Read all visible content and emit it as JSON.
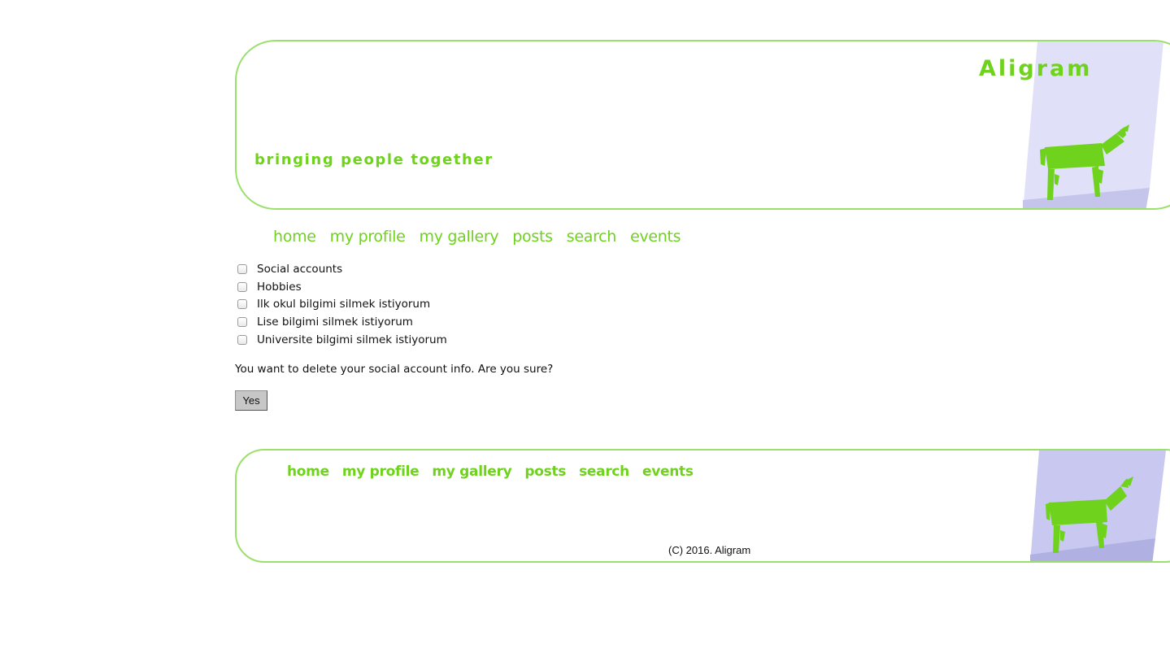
{
  "site": {
    "title": "Aligram",
    "tagline": "bringing people together",
    "brand_color": "#6fd21c",
    "border_color": "#9be06a"
  },
  "nav": {
    "items": [
      {
        "label": "home"
      },
      {
        "label": "my profile"
      },
      {
        "label": "my gallery"
      },
      {
        "label": "posts"
      },
      {
        "label": "search"
      },
      {
        "label": "events"
      }
    ]
  },
  "form": {
    "options": [
      {
        "label": "Social accounts",
        "checked": false
      },
      {
        "label": "Hobbies",
        "checked": false
      },
      {
        "label": "Ilk okul bilgimi silmek istiyorum",
        "checked": false
      },
      {
        "label": "Lise bilgimi silmek istiyorum",
        "checked": false
      },
      {
        "label": "Universite bilgimi silmek istiyorum",
        "checked": false
      }
    ],
    "question": "You want to delete your social account info. Are you sure?",
    "yes_label": "Yes"
  },
  "footer": {
    "nav": [
      {
        "label": "home"
      },
      {
        "label": "my profile"
      },
      {
        "label": "my gallery"
      },
      {
        "label": "posts"
      },
      {
        "label": "search"
      },
      {
        "label": "events"
      }
    ],
    "copyright": "(C) 2016. Aligram"
  },
  "icons": {
    "mascot": "green-donkey-icon"
  }
}
